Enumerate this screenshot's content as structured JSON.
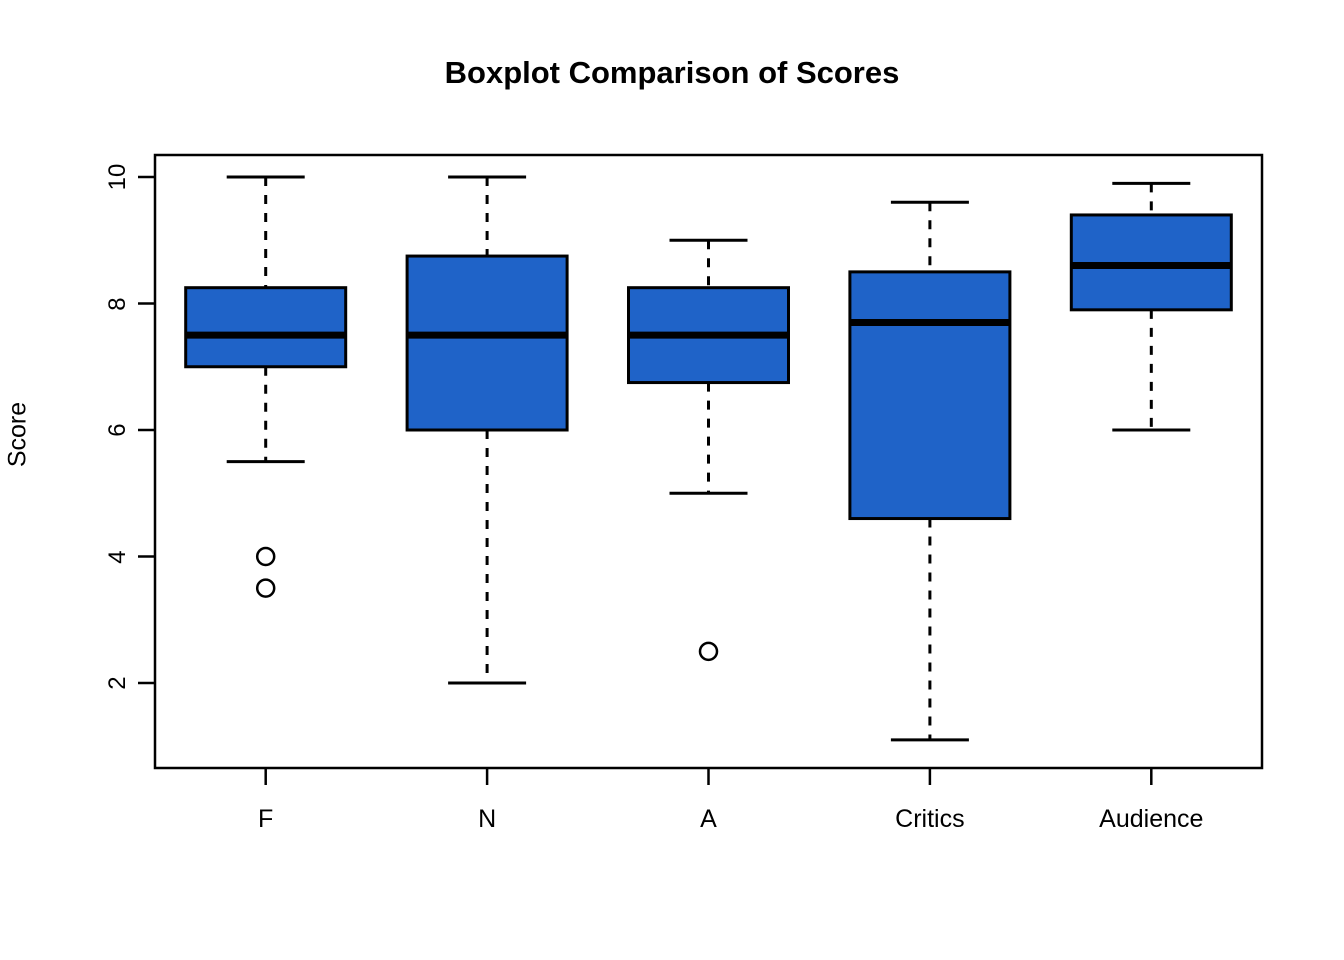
{
  "chart_data": {
    "type": "box",
    "title": "Boxplot Comparison of Scores",
    "xlabel": "",
    "ylabel": "Score",
    "ylim": [
      0.7,
      10.3
    ],
    "yticks": [
      2,
      4,
      6,
      8,
      10
    ],
    "ytick_labels": [
      "2",
      "4",
      "6",
      "8",
      "10"
    ],
    "grid": false,
    "legend": null,
    "categories": [
      "F",
      "N",
      "A",
      "Critics",
      "Audience"
    ],
    "boxes": [
      {
        "label": "F",
        "whisker_low": 5.5,
        "q1": 7.0,
        "median": 7.5,
        "q3": 8.25,
        "whisker_high": 10.0,
        "outliers": [
          4.0,
          3.5
        ]
      },
      {
        "label": "N",
        "whisker_low": 2.0,
        "q1": 6.0,
        "median": 7.5,
        "q3": 8.75,
        "whisker_high": 10.0,
        "outliers": []
      },
      {
        "label": "A",
        "whisker_low": 5.0,
        "q1": 6.75,
        "median": 7.5,
        "q3": 8.25,
        "whisker_high": 9.0,
        "outliers": [
          2.5
        ]
      },
      {
        "label": "Critics",
        "whisker_low": 1.1,
        "q1": 4.6,
        "median": 7.7,
        "q3": 8.5,
        "whisker_high": 9.6,
        "outliers": []
      },
      {
        "label": "Audience",
        "whisker_low": 6.0,
        "q1": 7.9,
        "median": 8.6,
        "q3": 9.4,
        "whisker_high": 9.9,
        "outliers": []
      }
    ],
    "colors": {
      "box_fill": "#1f63c8",
      "box_border": "#000000",
      "median": "#000000",
      "whisker": "#000000",
      "axis": "#000000",
      "background": "#ffffff"
    }
  }
}
